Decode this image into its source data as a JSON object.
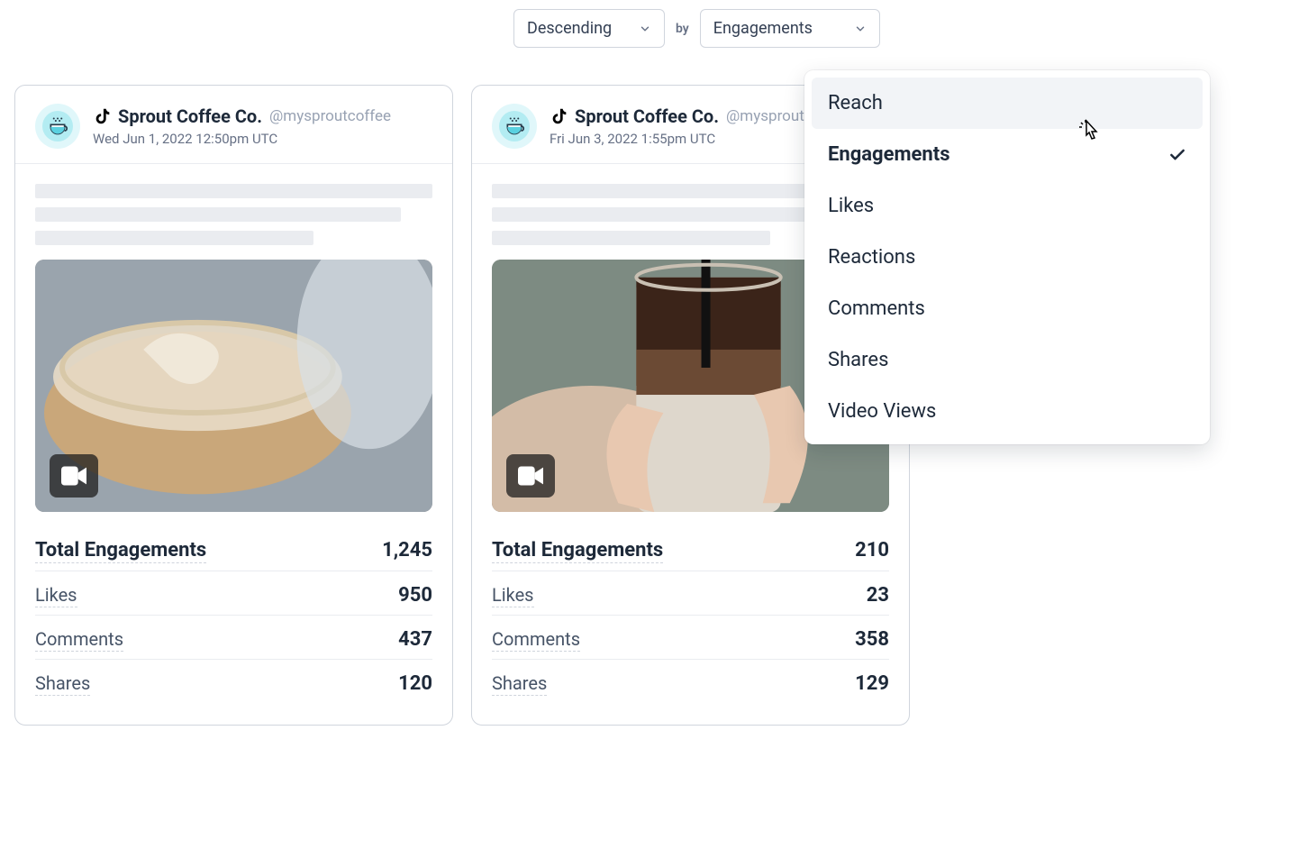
{
  "sort": {
    "order_label": "Descending",
    "by_label_separator": "by",
    "by_selected_label": "Engagements",
    "menu": [
      {
        "label": "Reach",
        "selected": false,
        "hovered": true
      },
      {
        "label": "Engagements",
        "selected": true,
        "hovered": false
      },
      {
        "label": "Likes",
        "selected": false,
        "hovered": false
      },
      {
        "label": "Reactions",
        "selected": false,
        "hovered": false
      },
      {
        "label": "Comments",
        "selected": false,
        "hovered": false
      },
      {
        "label": "Shares",
        "selected": false,
        "hovered": false
      },
      {
        "label": "Video Views",
        "selected": false,
        "hovered": false
      }
    ]
  },
  "cards": [
    {
      "profile_name": "Sprout Coffee Co.",
      "handle": "@mysproutcoffee",
      "timestamp": "Wed Jun 1, 2022 12:50pm UTC",
      "metrics": {
        "total_label": "Total Engagements",
        "total_value": "1,245",
        "rows": [
          {
            "label": "Likes",
            "value": "950"
          },
          {
            "label": "Comments",
            "value": "437"
          },
          {
            "label": "Shares",
            "value": "120"
          }
        ]
      },
      "image_variant": "latte"
    },
    {
      "profile_name": "Sprout Coffee Co.",
      "handle": "@mysproutcoffee",
      "timestamp": "Fri Jun 3, 2022 1:55pm UTC",
      "metrics": {
        "total_label": "Total Engagements",
        "total_value": "210",
        "rows": [
          {
            "label": "Likes",
            "value": "23"
          },
          {
            "label": "Comments",
            "value": "358"
          },
          {
            "label": "Shares",
            "value": "129"
          }
        ]
      },
      "image_variant": "iced"
    }
  ]
}
